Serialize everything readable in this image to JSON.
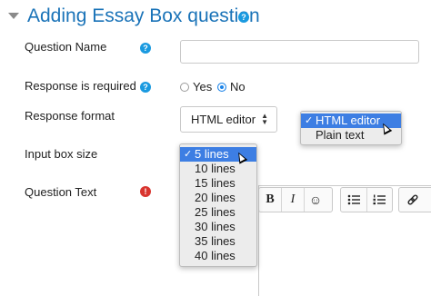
{
  "header": {
    "title": "Adding Essay Box question",
    "help_glyph": "?"
  },
  "fields": {
    "question_name": {
      "label": "Question Name",
      "value": "",
      "help_glyph": "?"
    },
    "response_required": {
      "label": "Response is required",
      "help_glyph": "?",
      "options": [
        {
          "label": "Yes",
          "checked": false
        },
        {
          "label": "No",
          "checked": true
        }
      ]
    },
    "response_format": {
      "label": "Response format",
      "value": "HTML editor",
      "arrows_up": "▲",
      "arrows_down": "▼",
      "menu": [
        {
          "label": "HTML editor",
          "selected": true
        },
        {
          "label": "Plain text",
          "selected": false
        }
      ]
    },
    "input_box_size": {
      "label": "Input box size",
      "menu": [
        {
          "label": "5 lines",
          "selected": true
        },
        {
          "label": "10 lines",
          "selected": false
        },
        {
          "label": "15 lines",
          "selected": false
        },
        {
          "label": "20 lines",
          "selected": false
        },
        {
          "label": "25 lines",
          "selected": false
        },
        {
          "label": "30 lines",
          "selected": false
        },
        {
          "label": "35 lines",
          "selected": false
        },
        {
          "label": "40 lines",
          "selected": false
        }
      ]
    },
    "question_text": {
      "label": "Question Text",
      "error_glyph": "!"
    }
  },
  "editor_toolbar": {
    "bold": "B",
    "italic": "I",
    "emoji": "☺",
    "check_glyph": "✓"
  },
  "colors": {
    "title": "#1a73b8",
    "help": "#1a9ae0",
    "error": "#d9352f",
    "selection": "#3d7ee3"
  }
}
